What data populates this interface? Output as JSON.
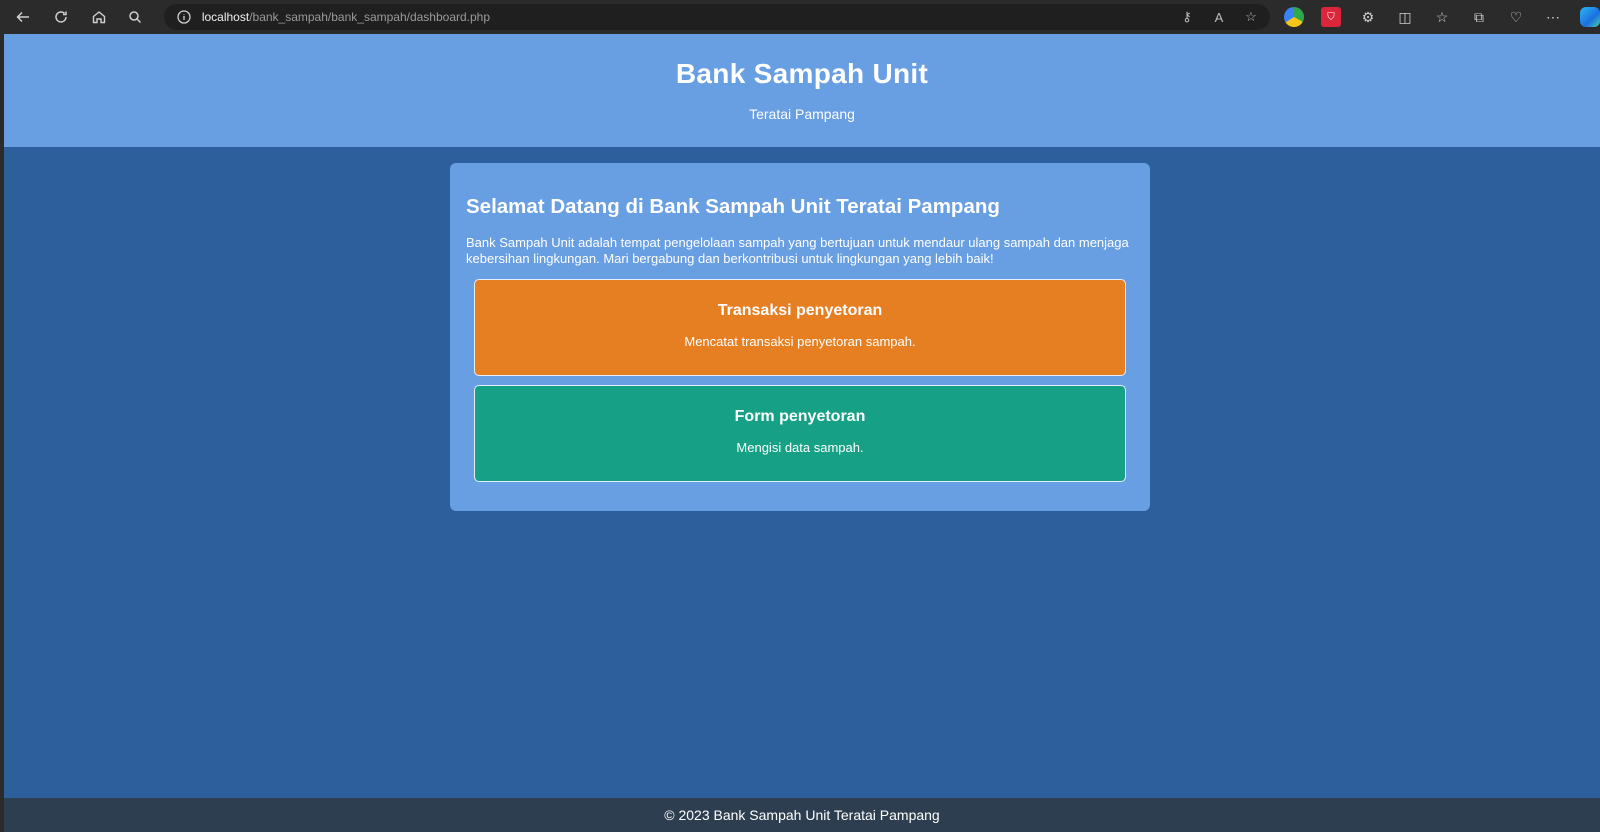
{
  "browser": {
    "url_host": "localhost",
    "url_path": "/bank_sampah/bank_sampah/dashboard.php",
    "nav_icons": [
      "back-icon",
      "reload-icon",
      "home-icon",
      "search-icon"
    ],
    "toolbar_icons": [
      "extension-green-icon",
      "extension-red-icon",
      "extensions-icon",
      "split-screen-icon",
      "favorites-icon",
      "collections-icon",
      "browser-essentials-icon",
      "more-icon",
      "copilot-icon"
    ]
  },
  "header": {
    "title": "Bank Sampah Unit",
    "subtitle": "Teratai Pampang"
  },
  "main": {
    "welcome_title": "Selamat Datang di Bank Sampah Unit Teratai Pampang",
    "welcome_text": "Bank Sampah Unit adalah tempat pengelolaan sampah yang bertujuan untuk mendaur ulang sampah dan menjaga kebersihan lingkungan. Mari bergabung dan berkontribusi untuk lingkungan yang lebih baik!",
    "cards": [
      {
        "title": "Transaksi penyetoran",
        "description": "Mencatat transaksi penyetoran sampah.",
        "color": "#e67e22"
      },
      {
        "title": "Form penyetoran",
        "description": "Mengisi data sampah.",
        "color": "#16a085"
      }
    ]
  },
  "footer": {
    "text": "© 2023 Bank Sampah Unit Teratai Pampang"
  },
  "colors": {
    "header_bg": "#689ee2",
    "page_bg": "#2c5f9b",
    "footer_bg": "#2c3e50"
  }
}
